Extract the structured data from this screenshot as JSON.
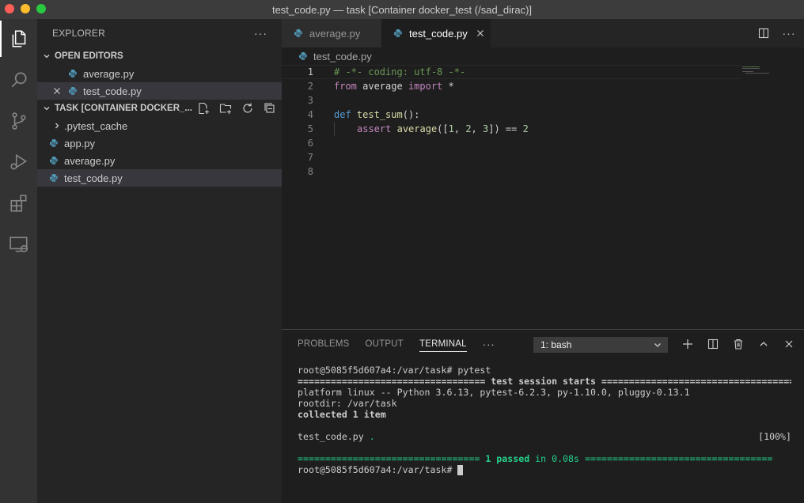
{
  "window": {
    "title": "test_code.py — task [Container docker_test (/sad_dirac)]"
  },
  "activity_bar": {
    "items": [
      "explorer-icon",
      "search-icon",
      "source-control-icon",
      "run-debug-icon",
      "extensions-icon",
      "remote-explorer-icon"
    ]
  },
  "sidebar": {
    "title": "EXPLORER",
    "more": "···",
    "open_editors": {
      "label": "OPEN EDITORS",
      "items": [
        {
          "name": "average.py"
        },
        {
          "name": "test_code.py"
        }
      ]
    },
    "workspace": {
      "label": "TASK [CONTAINER DOCKER_...",
      "items": [
        {
          "name": ".pytest_cache",
          "type": "folder"
        },
        {
          "name": "app.py",
          "type": "file"
        },
        {
          "name": "average.py",
          "type": "file"
        },
        {
          "name": "test_code.py",
          "type": "file"
        }
      ]
    }
  },
  "tabs": [
    {
      "label": "average.py",
      "active": false
    },
    {
      "label": "test_code.py",
      "active": true
    }
  ],
  "tab_actions_more": "···",
  "breadcrumb": "test_code.py",
  "editor": {
    "line_numbers": [
      "1",
      "2",
      "3",
      "4",
      "5",
      "6",
      "7",
      "8"
    ],
    "code": {
      "l1": "# -*- coding: utf-8 -*-",
      "l2_kw": "from",
      "l2_mod": " average ",
      "l2_kw2": "import",
      "l2_star": " *",
      "l4_kw": "def",
      "l4_fn": "test_sum",
      "l4_rest": "():",
      "l5_kw": "assert",
      "l5_fn": "average",
      "l5_p1": "([",
      "l5_n1": "1",
      "l5_c1": ", ",
      "l5_n2": "2",
      "l5_c2": ", ",
      "l5_n3": "3",
      "l5_p2": "]) == ",
      "l5_n4": "2"
    }
  },
  "panel": {
    "tabs": [
      "PROBLEMS",
      "OUTPUT",
      "TERMINAL"
    ],
    "active_tab": "TERMINAL",
    "more": "···",
    "terminal_select": "1: bash",
    "terminal": {
      "prompt1": "root@5085f5d607a4:/var/task# pytest",
      "session": "================================== test session starts ===================================",
      "platform": "platform linux -- Python 3.6.13, pytest-6.2.3, py-1.10.0, pluggy-0.13.1",
      "rootdir": "rootdir: /var/task",
      "collected": "collected 1 item",
      "result_file": "test_code.py ",
      "result_dot": ".",
      "result_pct": "[100%]",
      "passed_left": "================================= ",
      "passed_mid": "1 passed",
      "passed_time": " in 0.08s",
      "passed_right": " ==================================",
      "prompt2": "root@5085f5d607a4:/var/task# "
    }
  },
  "colors": {
    "python_icon": "#519aba",
    "accent_green": "#23d18b"
  }
}
